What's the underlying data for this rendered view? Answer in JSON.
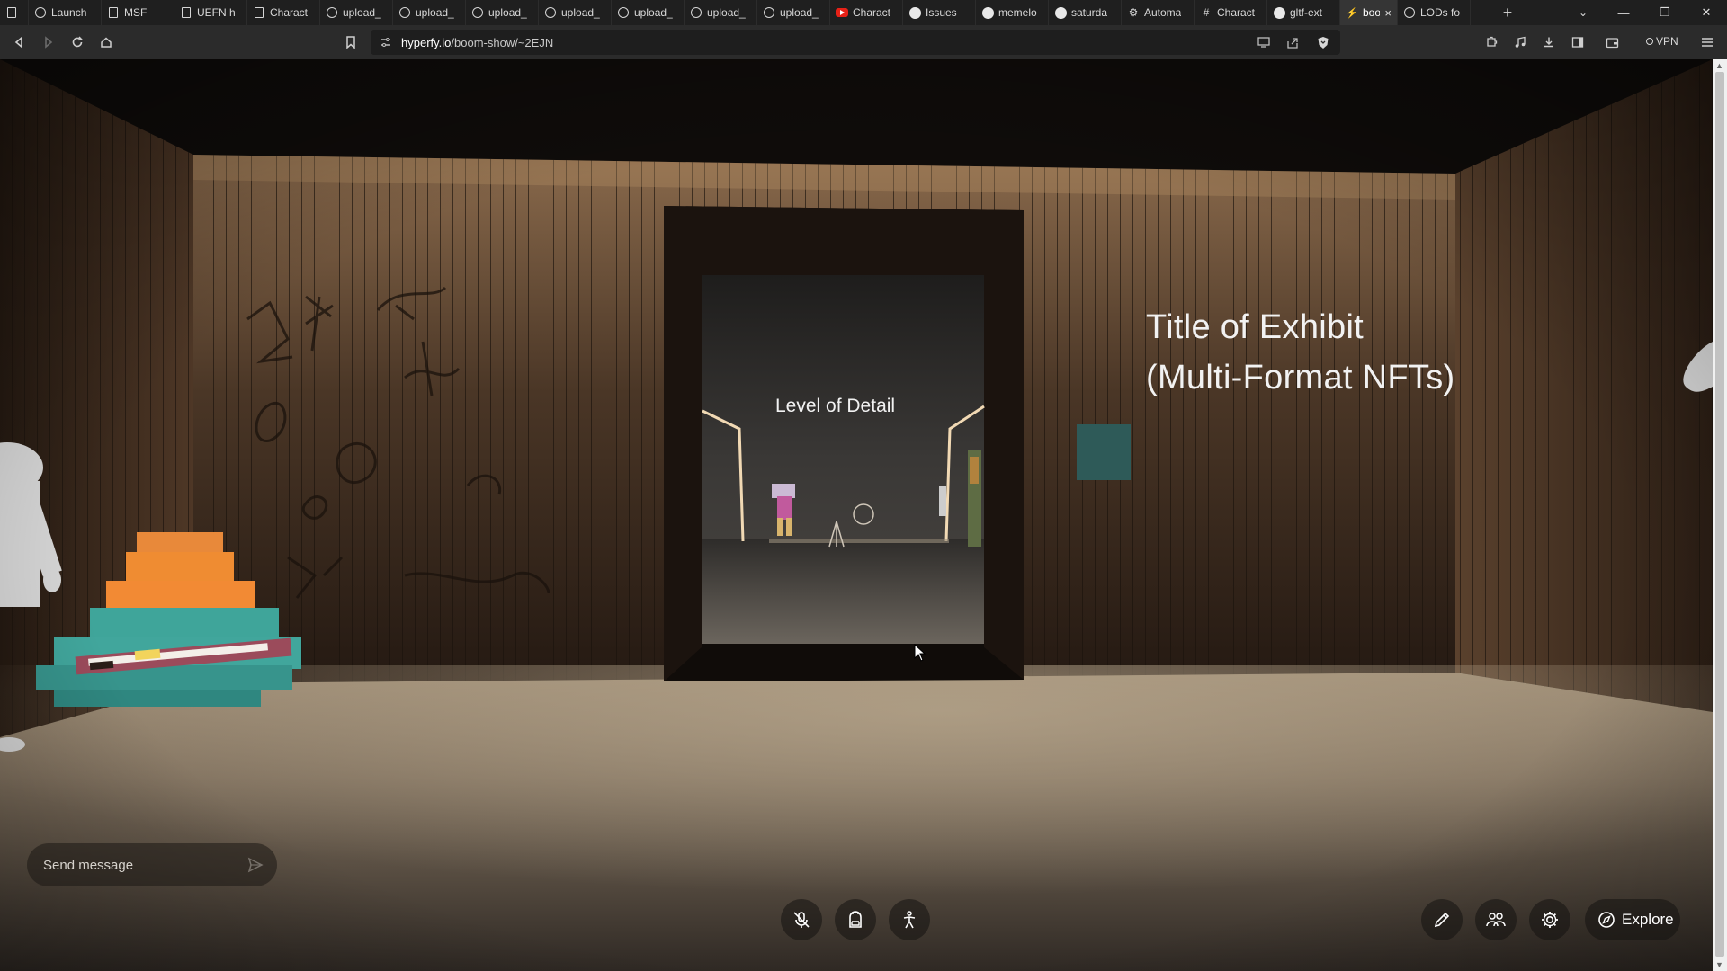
{
  "browser": {
    "tabs": [
      {
        "icon": "document-icon",
        "title": ""
      },
      {
        "icon": "globe-icon",
        "title": "Launch"
      },
      {
        "icon": "document-icon",
        "title": "MSF"
      },
      {
        "icon": "document-icon",
        "title": "UEFN h"
      },
      {
        "icon": "document-icon",
        "title": "Charact"
      },
      {
        "icon": "globe-icon",
        "title": "upload_"
      },
      {
        "icon": "globe-icon",
        "title": "upload_"
      },
      {
        "icon": "globe-icon",
        "title": "upload_"
      },
      {
        "icon": "globe-icon",
        "title": "upload_"
      },
      {
        "icon": "globe-icon",
        "title": "upload_"
      },
      {
        "icon": "globe-icon",
        "title": "upload_"
      },
      {
        "icon": "globe-icon",
        "title": "upload_"
      },
      {
        "icon": "youtube-icon",
        "title": "Charact"
      },
      {
        "icon": "github-icon",
        "title": "Issues"
      },
      {
        "icon": "github-icon",
        "title": "memelo"
      },
      {
        "icon": "github-icon",
        "title": "saturda"
      },
      {
        "icon": "gear-icon",
        "title": "Automa"
      },
      {
        "icon": "hash-icon",
        "title": "Charact"
      },
      {
        "icon": "github-icon",
        "title": "gltf-ext"
      },
      {
        "icon": "bolt-icon",
        "title": "boo",
        "active": true
      },
      {
        "icon": "globe-icon",
        "title": "LODs fo"
      }
    ],
    "url_host": "hyperfy.io",
    "url_path": "/boom-show/~2EJN",
    "vpn_label": "VPN"
  },
  "scene": {
    "exhibit_title_line1": "Title of Exhibit",
    "exhibit_title_line2": "(Multi-Format NFTs)",
    "doorway_label": "Level of Detail"
  },
  "hud": {
    "chat_placeholder": "Send message",
    "explore_label": "Explore"
  }
}
